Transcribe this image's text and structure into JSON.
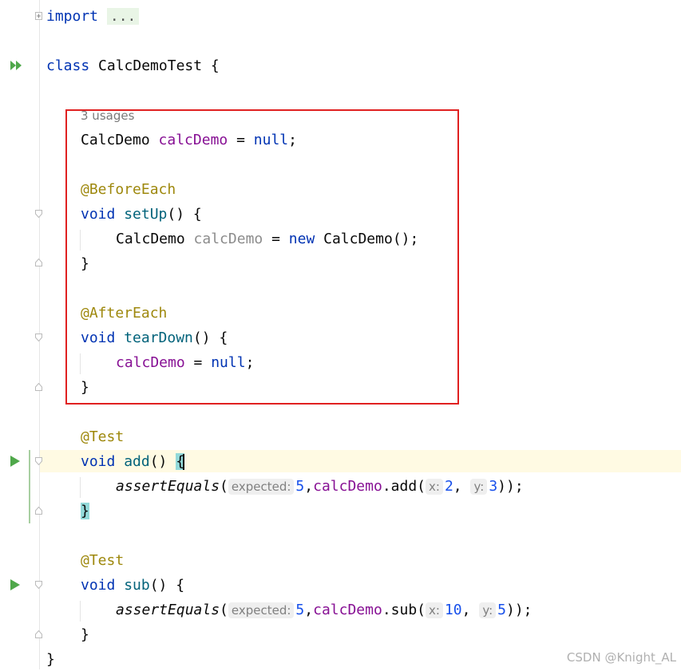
{
  "code": {
    "import_kw": "import",
    "import_fold": "...",
    "class_kw": "class",
    "class_name": "CalcDemoTest",
    "open_brace": "{",
    "close_brace": "}",
    "usages_hint": "3 usages",
    "field_type": "CalcDemo",
    "field_name": "calcDemo",
    "assign": " = ",
    "null_kw": "null",
    "semi": ";",
    "before_each": "@BeforeEach",
    "after_each": "@AfterEach",
    "test_ann": "@Test",
    "void_kw": "void",
    "setup_name": "setUp",
    "teardown_name": "tearDown",
    "add_name": "add",
    "sub_name": "sub",
    "parens": "()",
    "local_var": "calcDemo",
    "new_kw": "new",
    "ctor_call": "CalcDemo();",
    "assert_name": "assertEquals",
    "hint_expected": "expected:",
    "hint_x": "x:",
    "hint_y": "y:",
    "add_expected": "5",
    "add_x": "2",
    "add_y": "3",
    "sub_expected": "5",
    "sub_x": "10",
    "sub_y": "5",
    "add_call": ".add(",
    "sub_call": ".sub(",
    "close_call": "));"
  },
  "watermark": "CSDN @Knight_AL",
  "colors": {
    "keyword": "#0033b3",
    "annotation": "#9e880d",
    "field": "#871094",
    "number": "#1750eb",
    "highlight_box": "#e02020",
    "run_icon": "#4fa84a"
  }
}
